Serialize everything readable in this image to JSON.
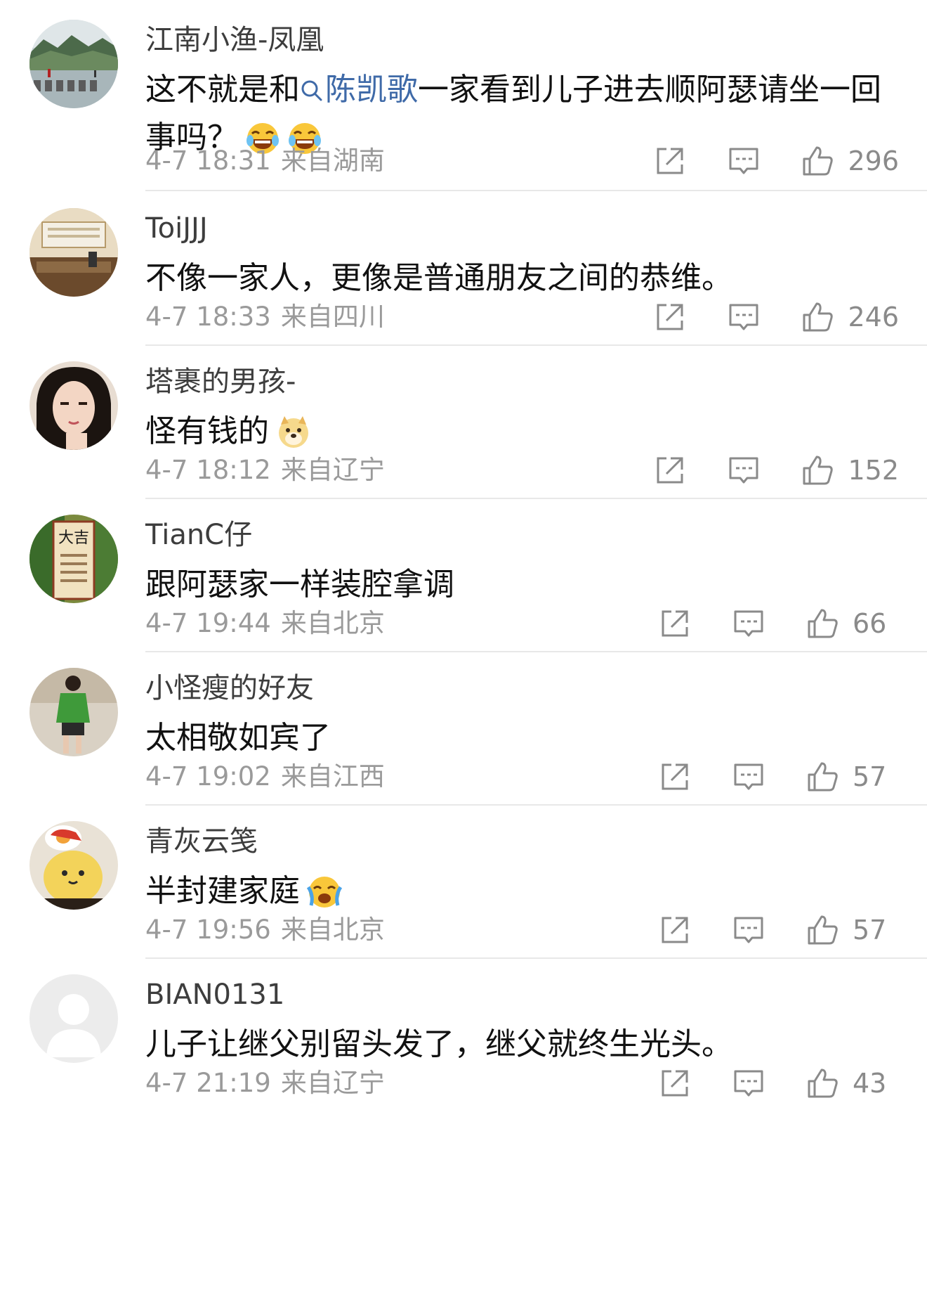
{
  "comments": [
    {
      "username": "江南小渔-凤凰",
      "text_before": "这不就是和",
      "highlight": "陈凯歌",
      "text_after": "一家看到儿子进去顺阿瑟请坐一回事吗？",
      "emojis": [
        "laughing-tears-emoji",
        "laughing-tears-emoji"
      ],
      "time": "4-7 18:31",
      "location": "来自湖南",
      "likes": "296",
      "avatar": "landscape-avatar"
    },
    {
      "username": "ToiJJJ",
      "text": "不像一家人，更像是普通朋友之间的恭维。",
      "time": "4-7 18:33",
      "location": "来自四川",
      "likes": "246",
      "avatar": "room-avatar"
    },
    {
      "username": "塔裹的男孩-",
      "text": "怪有钱的",
      "emojis": [
        "doge-emoji"
      ],
      "time": "4-7 18:12",
      "location": "来自辽宁",
      "likes": "152",
      "avatar": "girl-portrait-avatar"
    },
    {
      "username": "TianC仔",
      "text": "跟阿瑟家一样装腔拿调",
      "time": "4-7 19:44",
      "location": "来自北京",
      "likes": "66",
      "avatar": "lucky-sign-avatar",
      "avatar_text": "大吉"
    },
    {
      "username": "小怪瘦的好友",
      "text": "太相敬如宾了",
      "time": "4-7 19:02",
      "location": "来自江西",
      "likes": "57",
      "avatar": "person-green-shirt-avatar"
    },
    {
      "username": "青灰云笺",
      "text": "半封建家庭",
      "emojis": [
        "crying-laughing-emoji"
      ],
      "time": "4-7 19:56",
      "location": "来自北京",
      "likes": "57",
      "avatar": "plush-toy-avatar"
    },
    {
      "username": "BIAN0131",
      "text": "儿子让继父别留头发了，继父就终生光头。",
      "time": "4-7 21:19",
      "location": "来自辽宁",
      "likes": "43",
      "avatar": "default-avatar"
    }
  ],
  "colors": {
    "link": "#3f6aa8",
    "meta": "#9a9a9a",
    "divider": "#e8e8e8",
    "icon": "#8a8a8a"
  },
  "icons": {
    "share": "share-icon",
    "reply": "reply-icon",
    "like": "thumbs-up-icon",
    "search": "search-icon"
  }
}
